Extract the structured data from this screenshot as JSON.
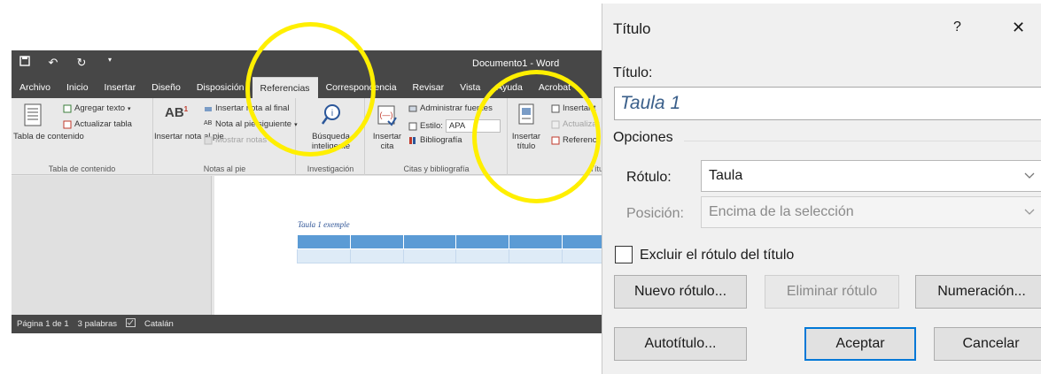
{
  "word": {
    "doc_title": "Documento1 - Word",
    "qat_icons": [
      "save-icon",
      "undo-icon",
      "redo-icon",
      "customize-icon"
    ],
    "tabs": [
      "Archivo",
      "Inicio",
      "Insertar",
      "Diseño",
      "Disposición",
      "Referencias",
      "Correspondencia",
      "Revisar",
      "Vista",
      "Ayuda",
      "Acrobat"
    ],
    "active_tab": "Referencias",
    "ribbon": {
      "toc": {
        "button": "Tabla de contenido",
        "add_text": "Agregar texto",
        "update_table": "Actualizar tabla",
        "group": "Tabla de contenido"
      },
      "footnotes": {
        "insert_footnote": "Insertar nota al pie",
        "insert_endnote": "Insertar nota al final",
        "next_footnote": "Nota al pie siguiente",
        "show_notes": "Mostrar notas",
        "group": "Notas al pie"
      },
      "research": {
        "smart_lookup": "Búsqueda inteligente",
        "group": "Investigación"
      },
      "citations": {
        "insert_citation": "Insertar cita",
        "manage_sources": "Administrar fuentes",
        "style_label": "Estilo:",
        "style_value": "APA",
        "bibliography": "Bibliografía",
        "group": "Citas y bibliografía"
      },
      "captions": {
        "insert_caption": "Insertar título",
        "insert_table_figures": "Insertar t",
        "update": "Actualizar",
        "cross_ref": "Referenc",
        "group": "Título"
      }
    },
    "document": {
      "caption_text": "Taula 1 exemple"
    },
    "status": {
      "page": "Página 1 de 1",
      "words": "3 palabras",
      "language": "Catalán"
    }
  },
  "dialog": {
    "title": "Título",
    "help": "?",
    "close": "✕",
    "caption_label": "Título:",
    "caption_value": "Taula 1",
    "options_label": "Opciones",
    "label_label": "Rótulo:",
    "label_value": "Taula",
    "position_label": "Posición:",
    "position_value": "Encima de la selección",
    "exclude_label": "Excluir el rótulo del título",
    "buttons": {
      "new_label": "Nuevo rótulo...",
      "delete_label": "Eliminar rótulo",
      "numbering": "Numeración...",
      "autocaption": "Autotítulo...",
      "ok": "Aceptar",
      "cancel": "Cancelar"
    }
  },
  "colors": {
    "highlight_circle": "#ffef00",
    "word_dark": "#474747",
    "table_header": "#5b9bd5",
    "table_body": "#deebf7",
    "caption_style": "#2f5496",
    "focus_blue": "#0078d7"
  }
}
